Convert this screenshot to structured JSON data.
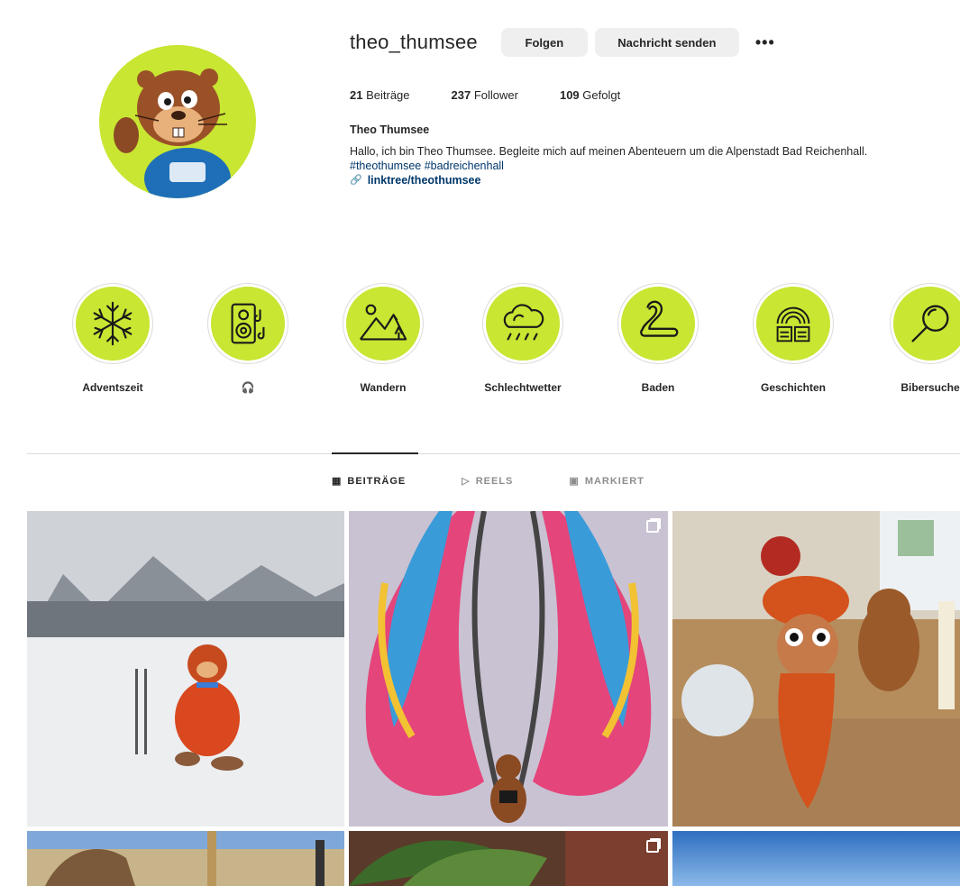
{
  "profile": {
    "username": "theo_thumsee",
    "follow_label": "Folgen",
    "message_label": "Nachricht senden",
    "more_label": "•••",
    "stats": {
      "posts_num": "21",
      "posts_label": "Beiträge",
      "followers_num": "237",
      "followers_label": "Follower",
      "following_num": "109",
      "following_label": "Gefolgt"
    },
    "full_name": "Theo Thumsee",
    "bio_line": "Hallo, ich bin Theo Thumsee. Begleite mich auf meinen Abenteuern um die Alpenstadt Bad Reichenhall.",
    "hashtags": "#theothumsee #badreichenhall",
    "link": "linktree/theothumsee"
  },
  "highlights": [
    {
      "label": "Adventszeit",
      "icon": "snowflake-icon"
    },
    {
      "label": "🎧",
      "icon": "speaker-music-icon"
    },
    {
      "label": "Wandern",
      "icon": "mountains-icon"
    },
    {
      "label": "Schlechtwetter",
      "icon": "rain-cloud-icon"
    },
    {
      "label": "Baden",
      "icon": "swan-icon"
    },
    {
      "label": "Geschichten",
      "icon": "book-rainbow-icon"
    },
    {
      "label": "Bibersuche",
      "icon": "magnifier-icon"
    }
  ],
  "tabs": {
    "posts": "BEITRÄGE",
    "reels": "REELS",
    "tagged": "MARKIERT"
  },
  "colors": {
    "accent": "#c8e632",
    "text": "#262626",
    "link": "#00376b"
  }
}
